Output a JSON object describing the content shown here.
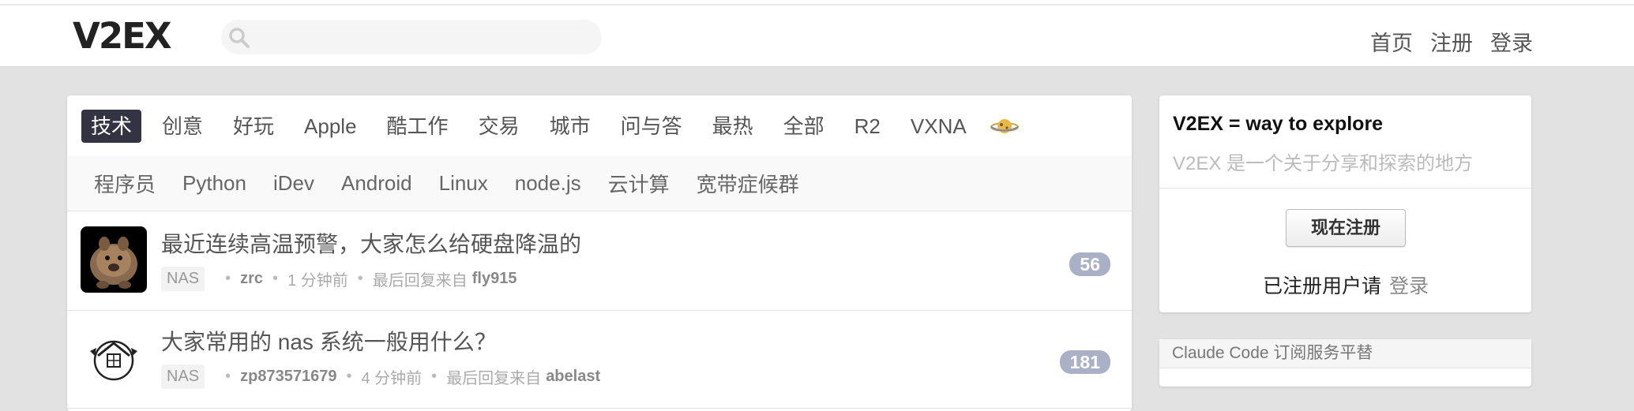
{
  "header": {
    "logo": "V2EX",
    "search_placeholder": "",
    "nav": [
      "首页",
      "注册",
      "登录"
    ]
  },
  "tabs": [
    "技术",
    "创意",
    "好玩",
    "Apple",
    "酷工作",
    "交易",
    "城市",
    "问与答",
    "最热",
    "全部",
    "R2",
    "VXNA"
  ],
  "active_tab": "技术",
  "subtabs": [
    "程序员",
    "Python",
    "iDev",
    "Android",
    "Linux",
    "node.js",
    "云计算",
    "宽带症候群"
  ],
  "topics": [
    {
      "title": "最近连续高温预警，大家怎么给硬盘降温的",
      "node": "NAS",
      "author": "zrc",
      "time": "1 分钟前",
      "last_reply_label": "最后回复来自",
      "last_replier": "fly915",
      "replies": "56"
    },
    {
      "title": "大家常用的 nas 系统一般用什么？",
      "node": "NAS",
      "author": "zp873571679",
      "time": "4 分钟前",
      "last_reply_label": "最后回复来自",
      "last_replier": "abelast",
      "replies": "181"
    }
  ],
  "sidebar": {
    "title": "V2EX = way to explore",
    "subtitle": "V2EX 是一个关于分享和探索的地方",
    "signup_button": "现在注册",
    "registered_text": "已注册用户请",
    "login_link": "登录",
    "promo_title": "Claude Code 订阅服务平替"
  },
  "colors": {
    "active_tab_bg": "#333344",
    "reply_badge": "#aab0c6",
    "page_bg": "#e2e2e2"
  }
}
